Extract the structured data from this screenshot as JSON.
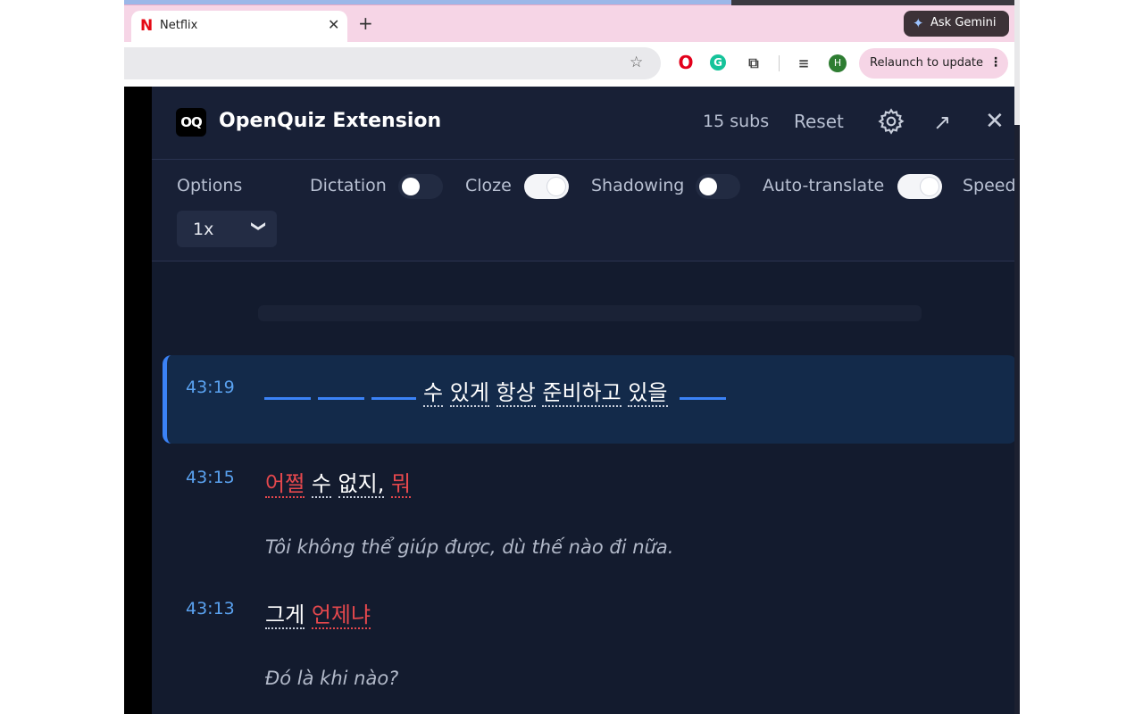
{
  "browser": {
    "tab_title": "Netflix",
    "tab_close_glyph": "✕",
    "new_tab_glyph": "+",
    "ask_gemini": "Ask Gemini",
    "relaunch": "Relaunch to update",
    "relaunch_menu_glyph": "⋮",
    "avatar_initial": "H",
    "icons": [
      "netflix-icon",
      "star-icon",
      "opera-icon",
      "grammarly-icon",
      "extensions-puzzle-icon",
      "media-control-icon",
      "avatar",
      "gemini-spark-icon"
    ]
  },
  "panel": {
    "logo": "OQ",
    "title": "OpenQuiz Extension",
    "subs_count": "15 subs",
    "reset": "Reset",
    "popout_glyph": "↗",
    "close_glyph": "✕"
  },
  "options": {
    "label": "Options",
    "dictation": {
      "label": "Dictation",
      "on": false
    },
    "cloze": {
      "label": "Cloze",
      "on": true
    },
    "shadowing": {
      "label": "Shadowing",
      "on": false
    },
    "auto_translate": {
      "label": "Auto-translate",
      "on": true
    },
    "speed_label": "Speed",
    "speed_value": "1x",
    "speed_chevron": "❯"
  },
  "subtitles": [
    {
      "time": "43:19",
      "active": true,
      "blanks_before": 3,
      "text_words": [
        "수",
        "있게",
        "항상",
        "준비하고",
        "있을"
      ],
      "blanks_after": 1
    },
    {
      "time": "43:15",
      "missed_1": "어쩔",
      "word_1": "수",
      "word_2": "없지,",
      "missed_2": "뭐",
      "translation": "Tôi không thể giúp được, dù thế nào đi nữa."
    },
    {
      "time": "43:13",
      "word_1": "그게",
      "missed_1": "언제냐",
      "translation": "Đó là khi nào?"
    }
  ],
  "colors": {
    "panel_bg": "#131b2e",
    "header_bg": "#182036",
    "accent_blue": "#3b82f6",
    "timestamp": "#5aa2f0",
    "missed_red": "#e5484d"
  }
}
